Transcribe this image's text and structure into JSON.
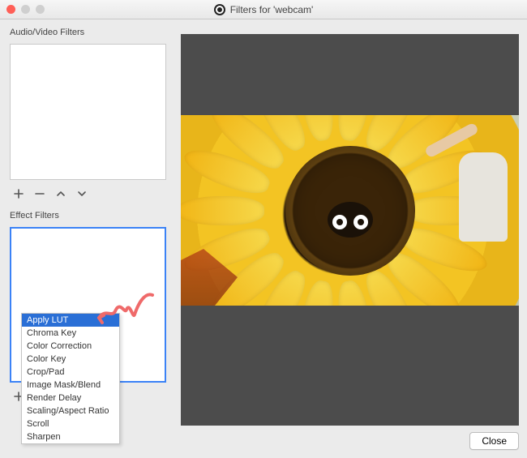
{
  "window": {
    "title": "Filters for 'webcam'"
  },
  "left": {
    "audio_video_label": "Audio/Video Filters",
    "effect_label": "Effect Filters"
  },
  "buttons": {
    "add": "+",
    "remove": "−",
    "up": "︿",
    "down": "﹀",
    "close": "Close"
  },
  "dropdown": {
    "items": [
      "Apply LUT",
      "Chroma Key",
      "Color Correction",
      "Color Key",
      "Crop/Pad",
      "Image Mask/Blend",
      "Render Delay",
      "Scaling/Aspect Ratio",
      "Scroll",
      "Sharpen"
    ],
    "selected_index": 0
  },
  "annotation": {
    "color": "#ef6a6a"
  }
}
